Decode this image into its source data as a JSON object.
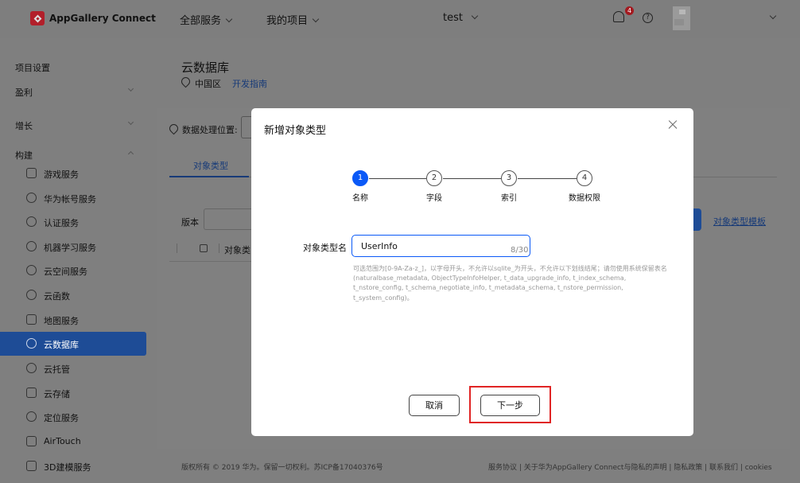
{
  "topbar": {
    "app_name": "AppGallery Connect",
    "all_services": "全部服务",
    "my_projects": "我的项目",
    "project": "test",
    "notification_count": "4",
    "help_symbol": "?"
  },
  "sidebar": {
    "groups": [
      "项目设置",
      "盈利",
      "增长",
      "构建"
    ],
    "items": [
      "游戏服务",
      "华为帐号服务",
      "认证服务",
      "机器学习服务",
      "云空间服务",
      "云函数",
      "地图服务",
      "云数据库",
      "云托管",
      "云存储",
      "定位服务",
      "AirTouch",
      "3D建模服务"
    ],
    "active_item": "云数据库"
  },
  "page": {
    "title": "云数据库",
    "region": "中国区",
    "guide_link": "开发指南",
    "location_label": "数据处理位置:",
    "tab_object_types": "对象类型",
    "version_label": "版本",
    "template_link": "对象类型模板",
    "column_object_type": "对象类"
  },
  "footer": {
    "left": "版权所有 © 2019 华为。保留一切权利。苏ICP备17040376号",
    "right": "服务协议 | 关于华为AppGallery Connect与隐私的声明 | 隐私政策 | 联系我们 | cookies"
  },
  "modal": {
    "title": "新增对象类型",
    "steps": [
      {
        "num": "1",
        "label": "名称"
      },
      {
        "num": "2",
        "label": "字段"
      },
      {
        "num": "3",
        "label": "索引"
      },
      {
        "num": "4",
        "label": "数据权限"
      }
    ],
    "active_step": 1,
    "field_label": "对象类型名",
    "field_value": "UserInfo",
    "char_count": "8/30",
    "hint": "可选范围为[0-9A-Za-z_]，以字母开头，不允许以sqlite_为开头，不允许以下划线结尾；请勿使用系统保留表名(naturalbase_metadata, ObjectTypeInfoHelper, t_data_upgrade_info, t_index_schema, t_nstore_config, t_schema_negotiate_info, t_metadata_schema, t_nstore_permission, t_system_config)。",
    "cancel_label": "取消",
    "next_label": "下一步"
  },
  "colors": {
    "primary": "#0a59f7",
    "dark_blue": "#1e4c96",
    "highlight": "#e02424",
    "overlay": "#7f7f7f"
  }
}
